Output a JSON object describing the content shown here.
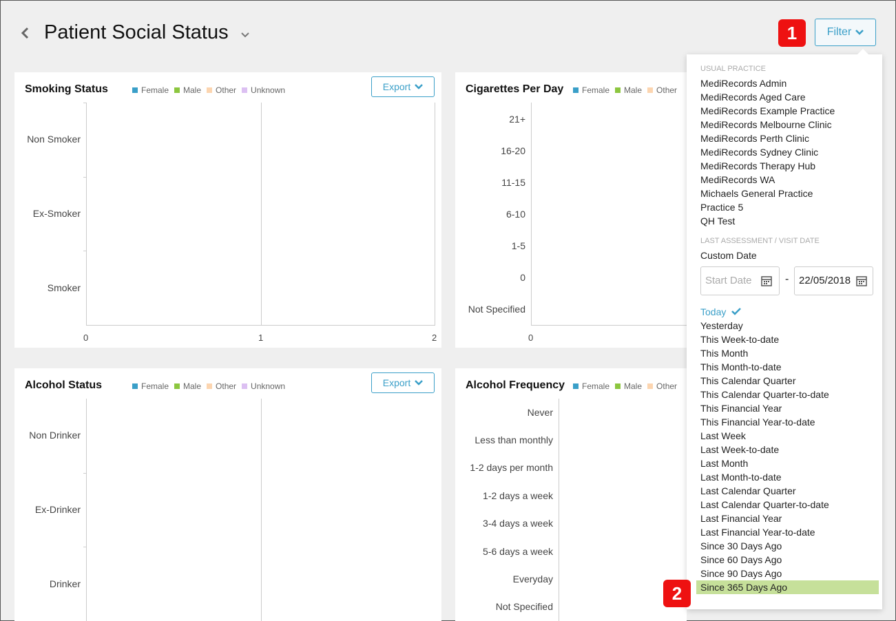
{
  "header": {
    "title": "Patient Social Status",
    "filter_label": "Filter",
    "badge1": "1",
    "badge2": "2"
  },
  "cards": {
    "smoking": {
      "title": "Smoking Status",
      "export_label": "Export",
      "categories": [
        "Non Smoker",
        "Ex-Smoker",
        "Smoker"
      ],
      "x_ticks": [
        "0",
        "1",
        "2"
      ]
    },
    "cigarettes": {
      "title": "Cigarettes Per Day",
      "categories": [
        "21+",
        "16-20",
        "11-15",
        "6-10",
        "1-5",
        "0",
        "Not Specified"
      ],
      "x_ticks": [
        "0"
      ]
    },
    "alcohol": {
      "title": "Alcohol Status",
      "export_label": "Export",
      "categories": [
        "Non Drinker",
        "Ex-Drinker",
        "Drinker"
      ]
    },
    "alcohol_freq": {
      "title": "Alcohol Frequency",
      "categories": [
        "Never",
        "Less than monthly",
        "1-2 days per month",
        "1-2 days a week",
        "3-4 days a week",
        "5-6 days a week",
        "Everyday",
        "Not Specified"
      ]
    }
  },
  "legend": {
    "full": [
      {
        "label": "Female",
        "color": "#3a9fc8"
      },
      {
        "label": "Male",
        "color": "#8cc63f"
      },
      {
        "label": "Other",
        "color": "#fcd5b0"
      },
      {
        "label": "Unknown",
        "color": "#dcc0f2"
      }
    ],
    "partial": [
      {
        "label": "Female",
        "color": "#3a9fc8"
      },
      {
        "label": "Male",
        "color": "#8cc63f"
      },
      {
        "label": "Other",
        "color": "#fcd5b0"
      }
    ]
  },
  "dropdown": {
    "usual_practice_label": "USUAL PRACTICE",
    "practices": [
      "MediRecords Admin",
      "MediRecords Aged Care",
      "MediRecords Example Practice",
      "MediRecords Melbourne Clinic",
      "MediRecords Perth Clinic",
      "MediRecords Sydney Clinic",
      "MediRecords Therapy Hub",
      "MediRecords WA",
      "Michaels General Practice",
      "Practice 5",
      "QH Test"
    ],
    "date_section_label": "LAST ASSESSMENT / VISIT DATE",
    "custom_date_label": "Custom Date",
    "start_date_placeholder": "Start Date",
    "end_date_value": "22/05/2018",
    "dash": "-",
    "ranges": [
      "Today",
      "Yesterday",
      "This Week-to-date",
      "This Month",
      "This Month-to-date",
      "This Calendar Quarter",
      "This Calendar Quarter-to-date",
      "This Financial Year",
      "This Financial Year-to-date",
      "Last Week",
      "Last Week-to-date",
      "Last Month",
      "Last Month-to-date",
      "Last Calendar Quarter",
      "Last Calendar Quarter-to-date",
      "Last Financial Year",
      "Last Financial Year-to-date",
      "Since 30 Days Ago",
      "Since 60 Days Ago",
      "Since 90 Days Ago",
      "Since 365 Days Ago"
    ],
    "selected_range": "Today",
    "highlighted_range": "Since 365 Days Ago"
  }
}
